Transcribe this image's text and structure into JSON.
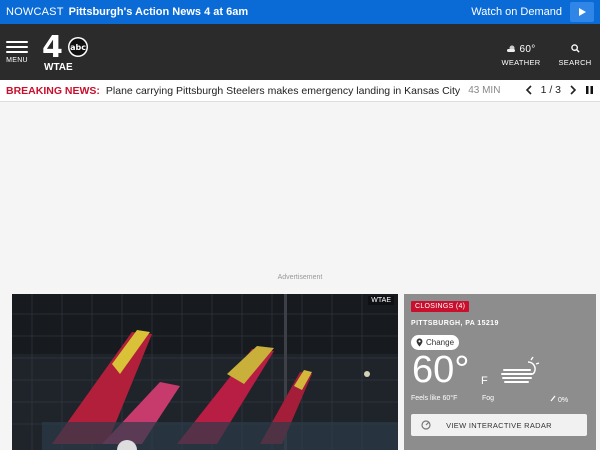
{
  "topbar": {
    "nowcast": "NOWCAST",
    "title": "Pittsburgh's Action News 4 at 6am",
    "watch": "Watch on Demand",
    "play_icon": "play-icon"
  },
  "header": {
    "menu_label": "MENU",
    "logo_text": "WTAE",
    "logo_number": "4",
    "logo_abc": "abc",
    "weather_temp": "60°",
    "weather_label": "WEATHER",
    "search_label": "SEARCH"
  },
  "breaking": {
    "label": "BREAKING NEWS:",
    "headline": "Plane carrying Pittsburgh Steelers makes emergency landing in Kansas City",
    "age": "43 MIN",
    "pager": "1 / 3"
  },
  "ad": {
    "label": "Advertisement"
  },
  "video": {
    "tag": "WTAE"
  },
  "weather_card": {
    "closings": "CLOSINGS (4)",
    "location": "PITTSBURGH, PA 15219",
    "change": "Change",
    "temp": "60°",
    "unit": "F",
    "feels": "Feels like 60°F",
    "condition": "Fog",
    "precip": "0%",
    "radar": "VIEW INTERACTIVE RADAR"
  },
  "colors": {
    "topbar": "#0a6ad6",
    "header": "#2b2b2b",
    "breaking_red": "#c8102e"
  }
}
